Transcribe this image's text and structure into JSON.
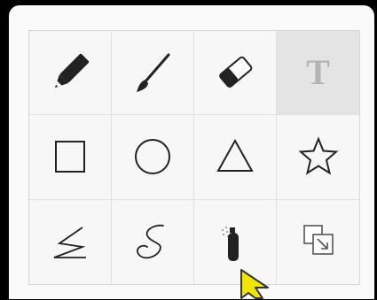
{
  "toolbox": {
    "tools": [
      {
        "id": "pencil",
        "icon": "pencil-icon",
        "selected": false
      },
      {
        "id": "brush",
        "icon": "brush-icon",
        "selected": false
      },
      {
        "id": "eraser",
        "icon": "eraser-icon",
        "selected": false
      },
      {
        "id": "text",
        "icon": "text-icon",
        "glyph": "T",
        "selected": true
      },
      {
        "id": "rectangle",
        "icon": "square-icon",
        "selected": false
      },
      {
        "id": "ellipse",
        "icon": "circle-icon",
        "selected": false
      },
      {
        "id": "triangle",
        "icon": "triangle-icon",
        "selected": false
      },
      {
        "id": "star",
        "icon": "star-icon",
        "selected": false
      },
      {
        "id": "polyline",
        "icon": "polyline-icon",
        "selected": false
      },
      {
        "id": "curve",
        "icon": "curve-icon",
        "selected": false
      },
      {
        "id": "spray",
        "icon": "spray-can-icon",
        "selected": false
      },
      {
        "id": "arrange",
        "icon": "bring-forward-icon",
        "selected": false
      }
    ]
  },
  "colors": {
    "icon_dark": "#222222",
    "text_tool_glyph": "#b4b4b4",
    "selected_bg": "#e4e4e4",
    "cursor_fill": "#f2e600"
  }
}
